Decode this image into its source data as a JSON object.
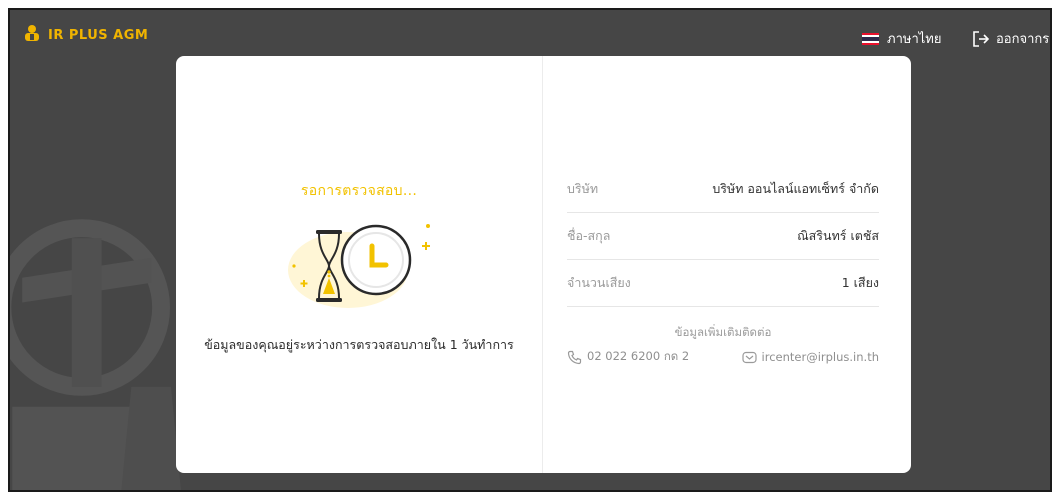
{
  "header": {
    "brand": "IR PLUS AGM",
    "language_label": "ภาษาไทย",
    "logout_label": "ออกจากระบบ"
  },
  "status": {
    "title": "รอการตรวจสอบ...",
    "message": "ข้อมูลของคุณอยู่ระหว่างการตรวจสอบภายใน 1 วันทำการ"
  },
  "details": {
    "rows": [
      {
        "label": "บริษัท",
        "value": "บริษัท ออนไลน์แอทเซ็ทร์ จำกัด"
      },
      {
        "label": "ชื่อ-สกุล",
        "value": "ณิสรินทร์ เตชัส"
      },
      {
        "label": "จำนวนเสียง",
        "value": "1 เสียง"
      }
    ]
  },
  "contact": {
    "title": "ข้อมูลเพิ่มเติมติดต่อ",
    "phone": "02 022 6200 กด 2",
    "email": "ircenter@irplus.in.th"
  },
  "colors": {
    "background": "#464646",
    "brand": "#f0b400",
    "status_title": "#f2c200",
    "card": "#ffffff"
  },
  "icons": {
    "brand": "agm-logo-icon",
    "language": "thai-flag-icon",
    "logout": "logout-icon",
    "phone": "phone-icon",
    "email": "email-icon",
    "waiting": "hourglass-clock-illustration"
  }
}
